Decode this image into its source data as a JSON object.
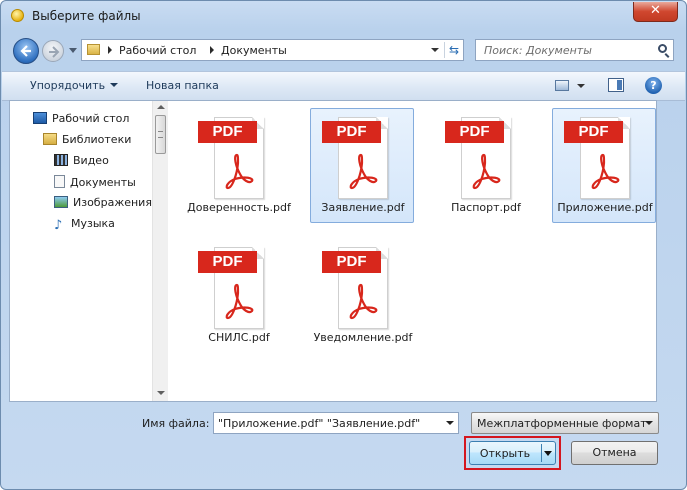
{
  "window": {
    "title": "Выберите файлы",
    "close_glyph": "✕"
  },
  "nav": {
    "breadcrumbs": [
      "Рабочий стол",
      "Документы"
    ],
    "search_placeholder": "Поиск: Документы"
  },
  "toolbar": {
    "organize_label": "Упорядочить",
    "new_folder_label": "Новая папка",
    "help_glyph": "?"
  },
  "navpane": {
    "items": [
      {
        "label": "Рабочий стол",
        "icon": "desktop-icon"
      },
      {
        "label": "Библиотеки",
        "icon": "libraries-icon"
      },
      {
        "label": "Видео",
        "icon": "video-icon"
      },
      {
        "label": "Документы",
        "icon": "documents-icon"
      },
      {
        "label": "Изображения",
        "icon": "images-icon"
      },
      {
        "label": "Музыка",
        "icon": "music-icon"
      }
    ]
  },
  "files": [
    {
      "name": "Доверенность.pdf",
      "badge": "PDF",
      "selected": false
    },
    {
      "name": "Заявление.pdf",
      "badge": "PDF",
      "selected": true
    },
    {
      "name": "Паспорт.pdf",
      "badge": "PDF",
      "selected": false
    },
    {
      "name": "Приложение.pdf",
      "badge": "PDF",
      "selected": true
    },
    {
      "name": "СНИЛС.pdf",
      "badge": "PDF",
      "selected": false
    },
    {
      "name": "Уведомление.pdf",
      "badge": "PDF",
      "selected": false
    }
  ],
  "footer": {
    "filename_label": "Имя файла:",
    "filename_value": "\"Приложение.pdf\" \"Заявление.pdf\"",
    "filter_value": "Межплатформенные формат",
    "open_label": "Открыть",
    "cancel_label": "Отмена"
  },
  "colors": {
    "pdf_red": "#d8271c",
    "selection_border": "#84acdd",
    "highlight_red": "#d4161f"
  }
}
